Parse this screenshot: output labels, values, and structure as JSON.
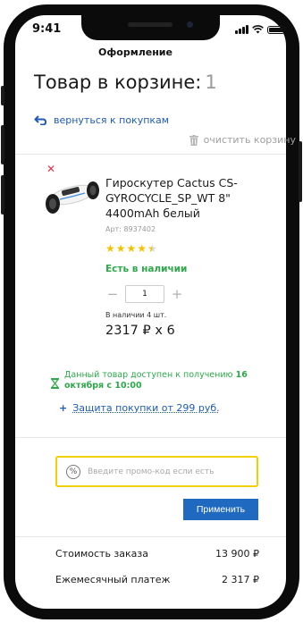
{
  "status_bar": {
    "time": "9:41"
  },
  "header": {
    "title": "Оформление"
  },
  "cart": {
    "title": "Товар в корзине:",
    "count": "1",
    "back_link": "вернуться к покупкам",
    "clear_link": "очистить корзину"
  },
  "product": {
    "name": "Гироскутер Cactus CS-GYROCYCLE_SP_WT 8\" 4400mAh белый",
    "sku": "Арт: 8937402",
    "rating": 4.5,
    "availability": "Есть в наличии",
    "quantity": "1",
    "stock_label": "В наличии 4 шт.",
    "price_line": "2317 ₽ x 6",
    "delivery_text": "Данный товар доступен к получению",
    "delivery_date": "16 октября с 10:00",
    "protection_link": "Защита покупки от 299 руб."
  },
  "promo": {
    "placeholder": "Введите промо-код если есть",
    "apply_label": "Применить"
  },
  "summary": [
    {
      "label": "Стоимость заказа",
      "value": "13 900 ₽"
    },
    {
      "label": "Ежемесячный платеж",
      "value": "2 317 ₽"
    }
  ],
  "colors": {
    "accent": "#1f5bb5",
    "button": "#1f6ac0",
    "in_stock": "#2ea84a",
    "promo_border": "#f0d000",
    "remove": "#e0334c"
  }
}
